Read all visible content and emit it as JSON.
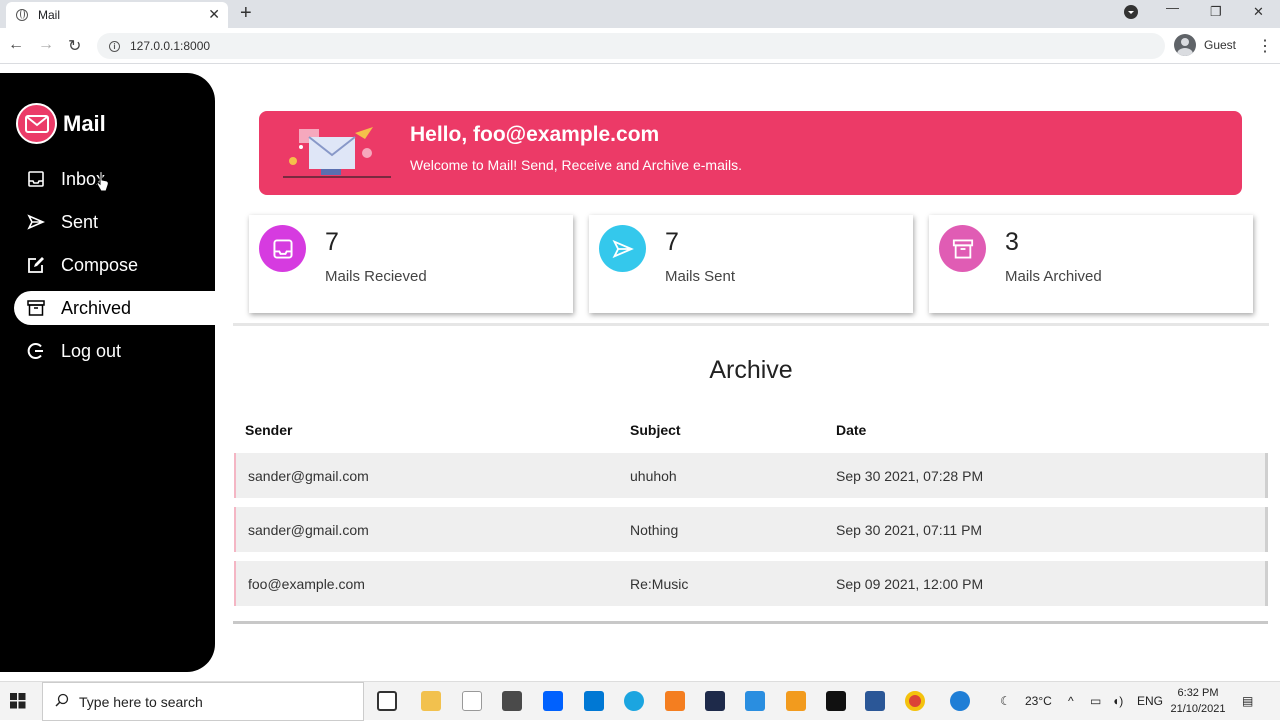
{
  "browser": {
    "tab_title": "Mail",
    "url": "127.0.0.1:8000",
    "profile": "Guest"
  },
  "sidebar": {
    "brand": "Mail",
    "items": [
      {
        "label": "Inbox",
        "icon": "inbox-icon"
      },
      {
        "label": "Sent",
        "icon": "send-icon"
      },
      {
        "label": "Compose",
        "icon": "compose-icon"
      },
      {
        "label": "Archived",
        "icon": "archive-icon",
        "active": true
      },
      {
        "label": "Log out",
        "icon": "logout-icon"
      }
    ]
  },
  "hero": {
    "greeting": "Hello, foo@example.com",
    "subtitle": "Welcome to Mail! Send, Receive and Archive e-mails."
  },
  "stats": [
    {
      "value": "7",
      "label": "Mails Recieved",
      "color": "#d63be0"
    },
    {
      "value": "7",
      "label": "Mails Sent",
      "color": "#34c8ec"
    },
    {
      "value": "3",
      "label": "Mails Archived",
      "color": "#e05cb4"
    }
  ],
  "archive": {
    "title": "Archive",
    "columns": [
      "Sender",
      "Subject",
      "Date"
    ],
    "rows": [
      {
        "sender": "sander@gmail.com",
        "subject": "uhuhoh",
        "date": "Sep 30 2021, 07:28 PM"
      },
      {
        "sender": "sander@gmail.com",
        "subject": "Nothing",
        "date": "Sep 30 2021, 07:11 PM"
      },
      {
        "sender": "foo@example.com",
        "subject": "Re:Music",
        "date": "Sep 09 2021, 12:00 PM"
      }
    ]
  },
  "taskbar": {
    "search_placeholder": "Type here to search",
    "weather": "23°C",
    "lang": "ENG",
    "time": "6:32 PM",
    "date": "21/10/2021"
  },
  "colors": {
    "accent": "#ec3a67",
    "sidebar": "#000000"
  }
}
